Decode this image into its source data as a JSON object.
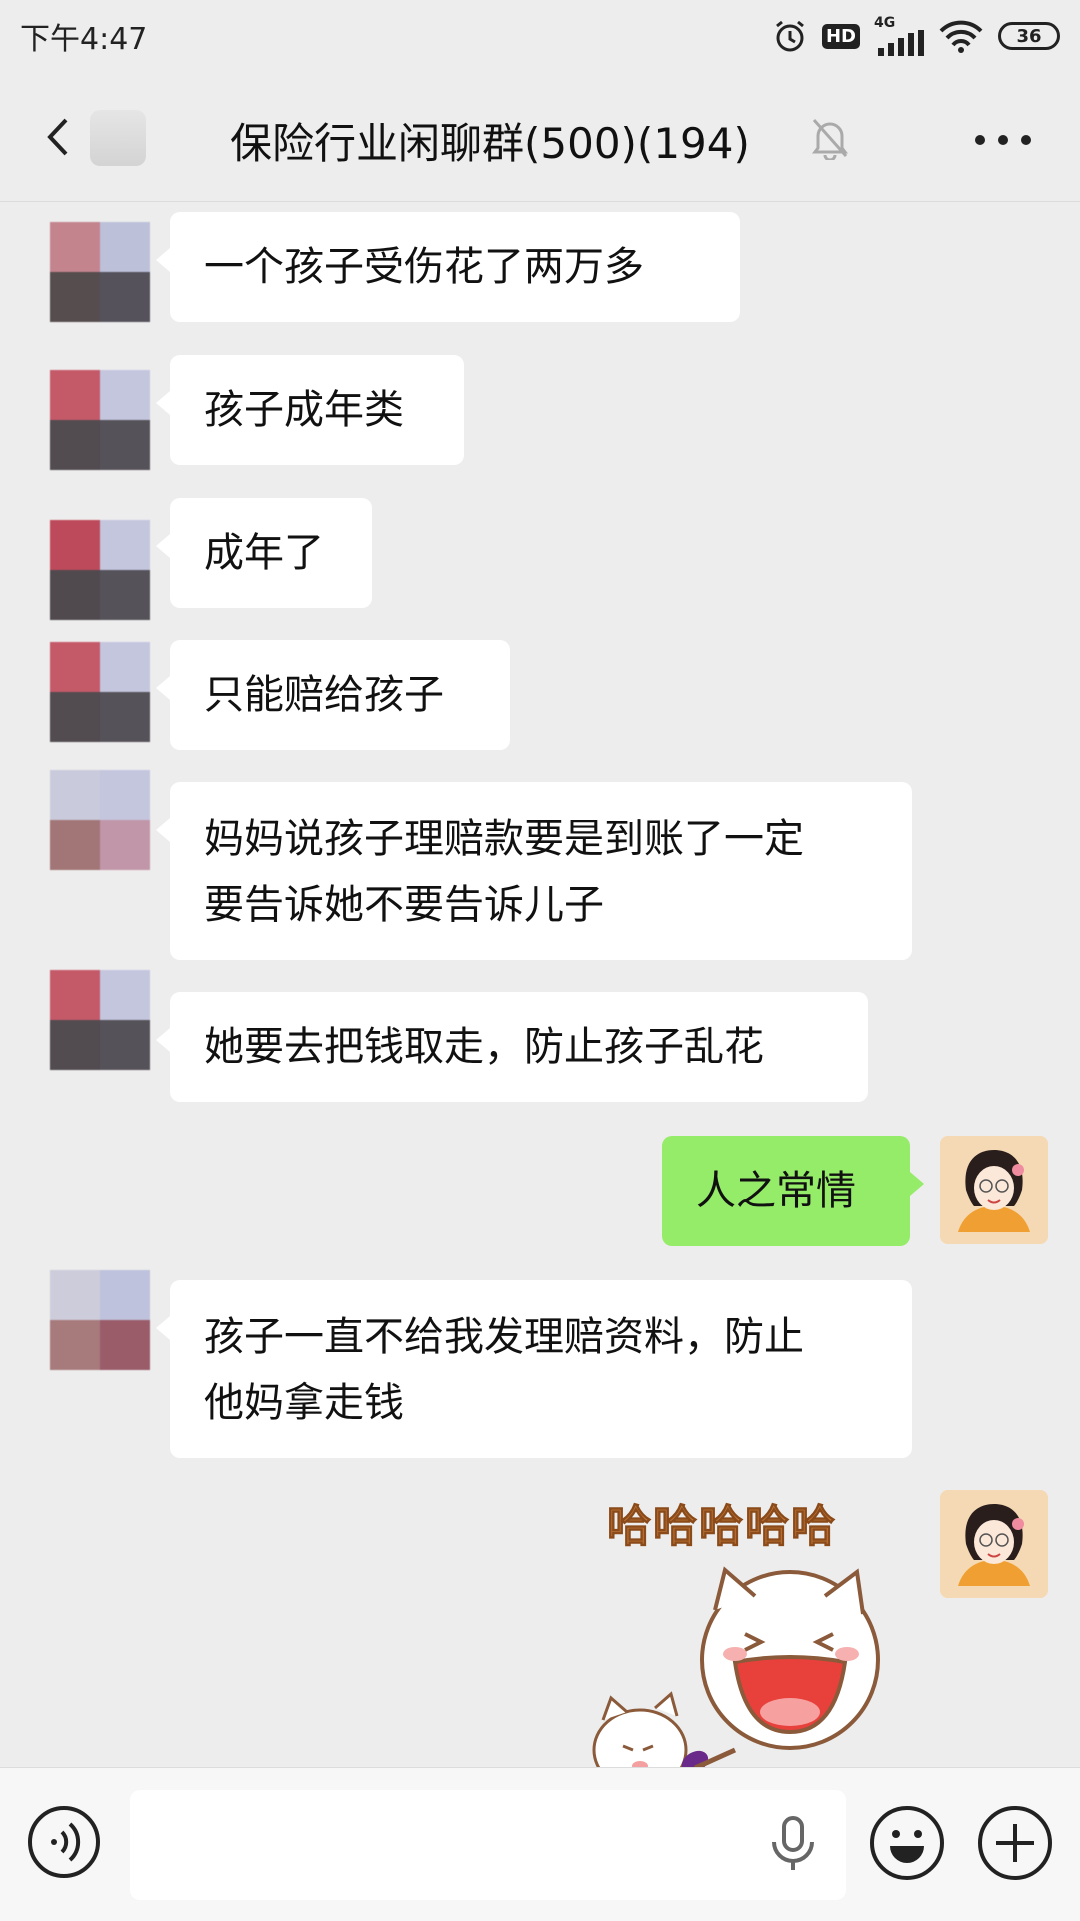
{
  "status_bar": {
    "time": "下午4:47",
    "hd_label": "HD",
    "network_label": "4G",
    "battery": "36"
  },
  "nav": {
    "title": "保险行业闲聊群(500)(194)"
  },
  "messages": [
    {
      "side": "left",
      "text": "一个孩子受伤花了两万多"
    },
    {
      "side": "left",
      "text": "孩子成年类"
    },
    {
      "side": "left",
      "text": "成年了"
    },
    {
      "side": "left",
      "text": "只能赔给孩子"
    },
    {
      "side": "left",
      "lines": [
        "妈妈说孩子理赔款要是到账了一定",
        "要告诉她不要告诉儿子"
      ]
    },
    {
      "side": "left",
      "text": "她要去把钱取走，防止孩子乱花"
    },
    {
      "side": "right",
      "text": "人之常情"
    },
    {
      "side": "left",
      "lines": [
        "孩子一直不给我发理赔资料，防止",
        "他妈拿走钱"
      ]
    }
  ],
  "sticker": {
    "caption": "哈哈哈哈哈",
    "icon": "laughing-cat-sticker"
  },
  "colors": {
    "background": "#ededed",
    "bubble_left": "#ffffff",
    "bubble_right": "#95ec69"
  }
}
